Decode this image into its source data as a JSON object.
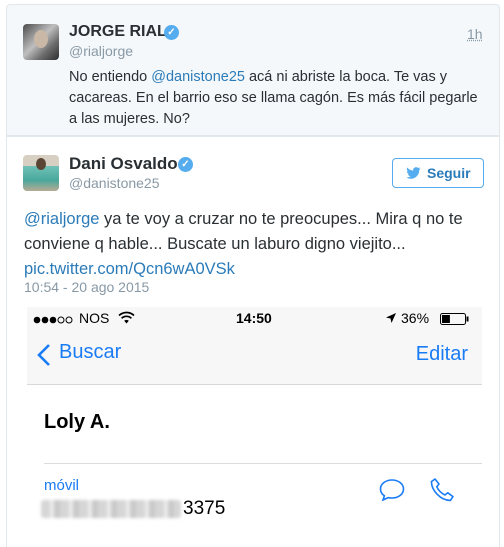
{
  "reply_tweet": {
    "author_name": "JORGE RIAL",
    "author_handle": "@rialjorge",
    "time": "1h",
    "text_before": "No entiendo ",
    "mention": "@danistone25",
    "text_after": " acá ni abriste la boca. Te vas y cacareas. En el barrio eso se llama cagón. Es más fácil pegarle a las mujeres. No?"
  },
  "main_tweet": {
    "author_name": "Dani Osvaldo",
    "author_handle": "@danistone25",
    "follow_label": "Seguir",
    "mention": "@rialjorge",
    "text_after": " ya te voy a cruzar no te preocupes... Mira q no te conviene q hable... Buscate un laburo digno viejito...",
    "link": "pic.twitter.com/Qcn6wA0VSk",
    "timestamp": "10:54 - 20 ago 2015"
  },
  "phone_screenshot": {
    "carrier": "NOS",
    "clock": "14:50",
    "battery": "36%",
    "battery_level": 0.36,
    "back_label": "Buscar",
    "edit_label": "Editar",
    "contact_name": "Loly A.",
    "phone_label": "móvil",
    "phone_number_visible": "3375"
  },
  "colors": {
    "twitter_blue": "#55acee",
    "link_blue": "#2b7bb9",
    "ios_blue": "#1a7cf5"
  }
}
